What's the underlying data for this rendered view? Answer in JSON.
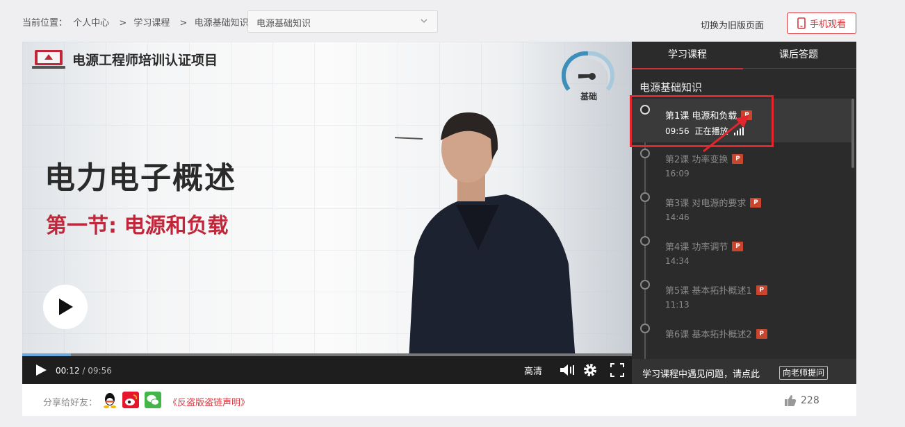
{
  "breadcrumb": {
    "prefix": "当前位置：",
    "items": [
      "个人中心",
      "学习课程",
      "电源基础知识"
    ],
    "separator": ">"
  },
  "course_select": {
    "value": "电源基础知识"
  },
  "header": {
    "old_version_link": "切换为旧版页面",
    "mobile_button": "手机观看"
  },
  "video": {
    "brand_title": "电源工程师培训认证项目",
    "level_label": "基础",
    "slide_title": "电力电子概述",
    "slide_subtitle": "第一节: 电源和负载",
    "progress_fraction": 0.08,
    "current_time": "00:12",
    "time_separator": " / ",
    "duration": "09:56",
    "quality_label": "高清"
  },
  "sidebar": {
    "tabs": [
      {
        "label": "学习课程",
        "active": true
      },
      {
        "label": "课后答题",
        "active": false
      }
    ],
    "section_title": "电源基础知识",
    "lessons": [
      {
        "title": "第1课 电源和负载",
        "duration": "09:56",
        "status": "正在播放",
        "current": true
      },
      {
        "title": "第2课 功率变换",
        "duration": "16:09",
        "status": "",
        "current": false
      },
      {
        "title": "第3课 对电源的要求",
        "duration": "14:46",
        "status": "",
        "current": false
      },
      {
        "title": "第4课 功率调节",
        "duration": "14:34",
        "status": "",
        "current": false
      },
      {
        "title": "第5课 基本拓扑概述1",
        "duration": "11:13",
        "status": "",
        "current": false
      },
      {
        "title": "第6课 基本拓扑概述2",
        "duration": "",
        "status": "",
        "current": false
      }
    ],
    "ppt_badge": "P",
    "footer_text": "学习课程中遇见问题，请点此",
    "ask_button": "向老师提问"
  },
  "bottom": {
    "share_label": "分享给好友：",
    "disclaimer": "《反盗版盗链声明》",
    "like_count": "228"
  },
  "colors": {
    "accent_red": "#d9363e",
    "sidebar_bg": "#2b2b2b",
    "progress_fill": "#6aa9e0"
  }
}
